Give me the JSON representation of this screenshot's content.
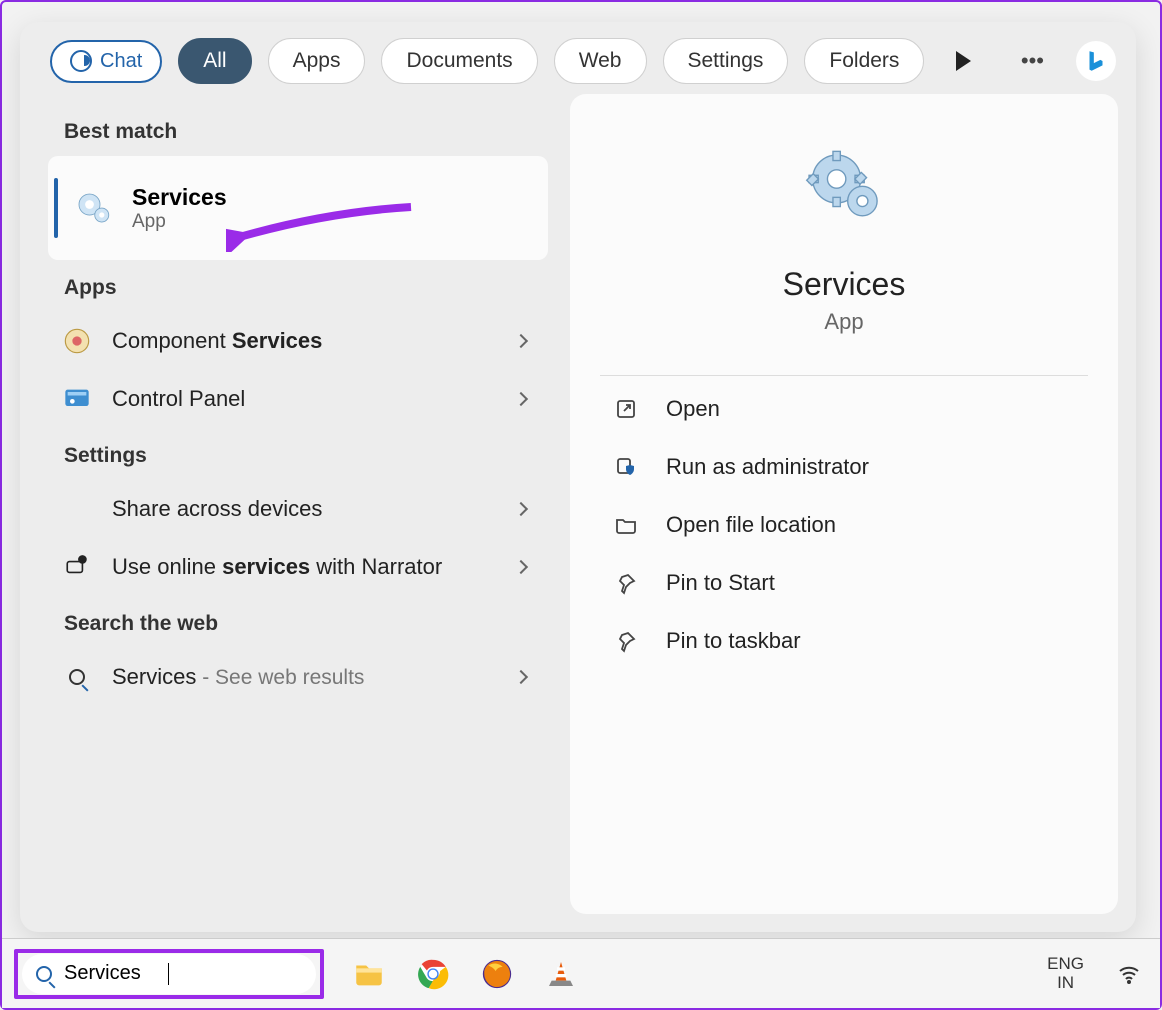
{
  "chat_label": "Chat",
  "tabs": [
    "All",
    "Apps",
    "Documents",
    "Web",
    "Settings",
    "Folders"
  ],
  "active_tab_index": 0,
  "sections": {
    "best_match": "Best match",
    "apps": "Apps",
    "settings": "Settings",
    "search_web": "Search the web"
  },
  "best_match": {
    "title": "Services",
    "type": "App"
  },
  "apps_rows": [
    {
      "label_pre": "Component ",
      "label_bold": "Services",
      "label_post": "",
      "icon": "component-services-icon"
    },
    {
      "label_pre": "Control Panel",
      "label_bold": "",
      "label_post": "",
      "icon": "control-panel-icon"
    }
  ],
  "settings_rows": [
    {
      "label_pre": "Share across devices",
      "label_bold": "",
      "label_post": ""
    },
    {
      "label_pre": "Use online ",
      "label_bold": "services",
      "label_post": " with Narrator"
    }
  ],
  "web_row": {
    "label_pre": "Services",
    "suffix": " - See web results"
  },
  "preview": {
    "title": "Services",
    "type": "App",
    "actions": [
      "Open",
      "Run as administrator",
      "Open file location",
      "Pin to Start",
      "Pin to taskbar"
    ]
  },
  "taskbar": {
    "search_value": "Services",
    "lang1": "ENG",
    "lang2": "IN"
  }
}
